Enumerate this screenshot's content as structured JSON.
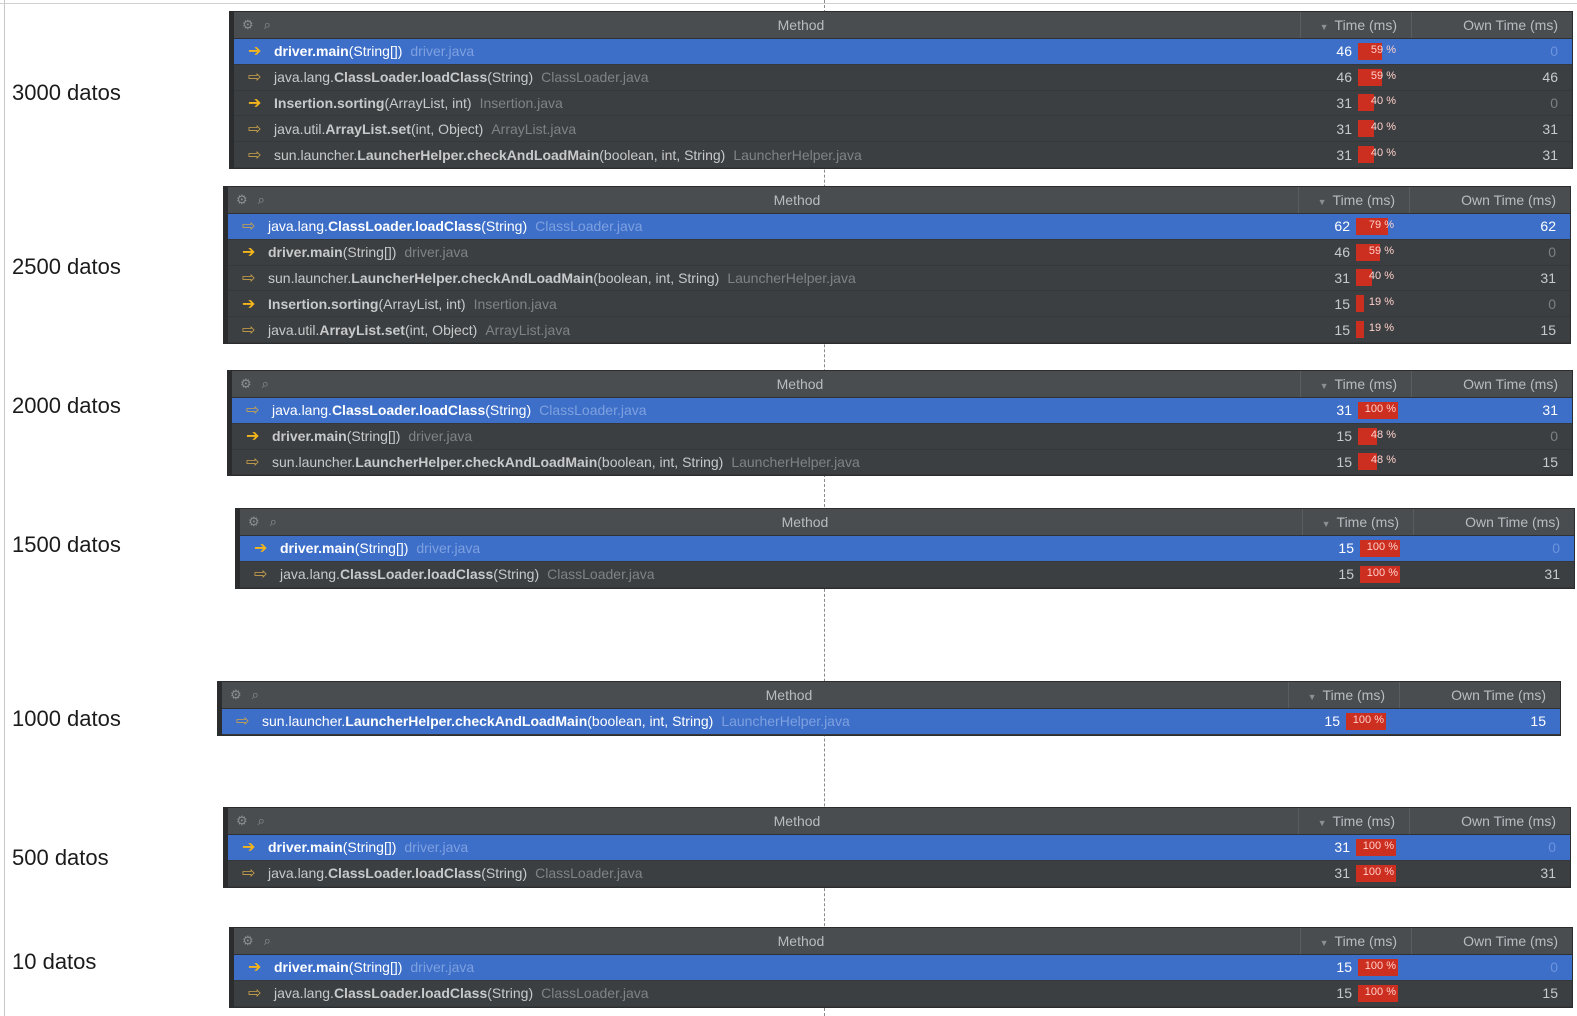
{
  "columns": {
    "method": "Method",
    "time": "Time (ms)",
    "own_time": "Own Time (ms)"
  },
  "icons": {
    "settings": "gear-icon",
    "search": "search-icon",
    "call": "arrow-right-icon"
  },
  "colors": {
    "selected_row": "#3d6fc9",
    "percent_bar": "#cc2e20",
    "arrow": "#f3b51b",
    "panel_bg": "#3c3f41"
  },
  "sections": [
    {
      "label": "3000 datos",
      "rows": [
        {
          "selected": true,
          "solid": true,
          "pkg": "",
          "name": "driver.main",
          "args": "(String[])",
          "file": "driver.java",
          "time": "46",
          "pct": "59 %",
          "frac": 0.59,
          "own": "0"
        },
        {
          "selected": false,
          "solid": false,
          "pkg": "java.lang.",
          "name": "ClassLoader.loadClass",
          "args": "(String)",
          "file": "ClassLoader.java",
          "time": "46",
          "pct": "59 %",
          "frac": 0.59,
          "own": "46"
        },
        {
          "selected": false,
          "solid": true,
          "pkg": "",
          "name": "Insertion.sorting",
          "args": "(ArrayList, int)",
          "file": "Insertion.java",
          "time": "31",
          "pct": "40 %",
          "frac": 0.4,
          "own": "0"
        },
        {
          "selected": false,
          "solid": false,
          "pkg": "java.util.",
          "name": "ArrayList.set",
          "args": "(int, Object)",
          "file": "ArrayList.java",
          "time": "31",
          "pct": "40 %",
          "frac": 0.4,
          "own": "31"
        },
        {
          "selected": false,
          "solid": false,
          "pkg": "sun.launcher.",
          "name": "LauncherHelper.checkAndLoadMain",
          "args": "(boolean, int, String)",
          "file": "LauncherHelper.java",
          "time": "31",
          "pct": "40 %",
          "frac": 0.4,
          "own": "31"
        }
      ]
    },
    {
      "label": "2500 datos",
      "rows": [
        {
          "selected": true,
          "solid": false,
          "pkg": "java.lang.",
          "name": "ClassLoader.loadClass",
          "args": "(String)",
          "file": "ClassLoader.java",
          "time": "62",
          "pct": "79 %",
          "frac": 0.79,
          "own": "62"
        },
        {
          "selected": false,
          "solid": true,
          "pkg": "",
          "name": "driver.main",
          "args": "(String[])",
          "file": "driver.java",
          "time": "46",
          "pct": "59 %",
          "frac": 0.59,
          "own": "0"
        },
        {
          "selected": false,
          "solid": false,
          "pkg": "sun.launcher.",
          "name": "LauncherHelper.checkAndLoadMain",
          "args": "(boolean, int, String)",
          "file": "LauncherHelper.java",
          "time": "31",
          "pct": "40 %",
          "frac": 0.4,
          "own": "31"
        },
        {
          "selected": false,
          "solid": true,
          "pkg": "",
          "name": "Insertion.sorting",
          "args": "(ArrayList, int)",
          "file": "Insertion.java",
          "time": "15",
          "pct": "19 %",
          "frac": 0.19,
          "own": "0"
        },
        {
          "selected": false,
          "solid": false,
          "pkg": "java.util.",
          "name": "ArrayList.set",
          "args": "(int, Object)",
          "file": "ArrayList.java",
          "time": "15",
          "pct": "19 %",
          "frac": 0.19,
          "own": "15"
        }
      ]
    },
    {
      "label": "2000 datos",
      "rows": [
        {
          "selected": true,
          "solid": false,
          "pkg": "java.lang.",
          "name": "ClassLoader.loadClass",
          "args": "(String)",
          "file": "ClassLoader.java",
          "time": "31",
          "pct": "100 %",
          "frac": 1.0,
          "own": "31"
        },
        {
          "selected": false,
          "solid": true,
          "pkg": "",
          "name": "driver.main",
          "args": "(String[])",
          "file": "driver.java",
          "time": "15",
          "pct": "48 %",
          "frac": 0.48,
          "own": "0"
        },
        {
          "selected": false,
          "solid": false,
          "pkg": "sun.launcher.",
          "name": "LauncherHelper.checkAndLoadMain",
          "args": "(boolean, int, String)",
          "file": "LauncherHelper.java",
          "time": "15",
          "pct": "48 %",
          "frac": 0.48,
          "own": "15"
        }
      ]
    },
    {
      "label": "1500 datos",
      "rows": [
        {
          "selected": true,
          "solid": true,
          "pkg": "",
          "name": "driver.main",
          "args": "(String[])",
          "file": "driver.java",
          "time": "15",
          "pct": "100 %",
          "frac": 1.0,
          "own": "0"
        },
        {
          "selected": false,
          "solid": false,
          "pkg": "java.lang.",
          "name": "ClassLoader.loadClass",
          "args": "(String)",
          "file": "ClassLoader.java",
          "time": "15",
          "pct": "100 %",
          "frac": 1.0,
          "own": "31"
        }
      ]
    },
    {
      "label": "1000 datos",
      "rows": [
        {
          "selected": true,
          "solid": false,
          "pkg": "sun.launcher.",
          "name": "LauncherHelper.checkAndLoadMain",
          "args": "(boolean, int, String)",
          "file": "LauncherHelper.java",
          "time": "15",
          "pct": "100 %",
          "frac": 1.0,
          "own": "15"
        }
      ]
    },
    {
      "label": "500 datos",
      "rows": [
        {
          "selected": true,
          "solid": true,
          "pkg": "",
          "name": "driver.main",
          "args": "(String[])",
          "file": "driver.java",
          "time": "31",
          "pct": "100 %",
          "frac": 1.0,
          "own": "0"
        },
        {
          "selected": false,
          "solid": false,
          "pkg": "java.lang.",
          "name": "ClassLoader.loadClass",
          "args": "(String)",
          "file": "ClassLoader.java",
          "time": "31",
          "pct": "100 %",
          "frac": 1.0,
          "own": "31"
        }
      ]
    },
    {
      "label": "10 datos",
      "rows": [
        {
          "selected": true,
          "solid": true,
          "pkg": "",
          "name": "driver.main",
          "args": "(String[])",
          "file": "driver.java",
          "time": "15",
          "pct": "100 %",
          "frac": 1.0,
          "own": "0"
        },
        {
          "selected": false,
          "solid": false,
          "pkg": "java.lang.",
          "name": "ClassLoader.loadClass",
          "args": "(String)",
          "file": "ClassLoader.java",
          "time": "15",
          "pct": "100 %",
          "frac": 1.0,
          "own": "15"
        }
      ]
    }
  ]
}
